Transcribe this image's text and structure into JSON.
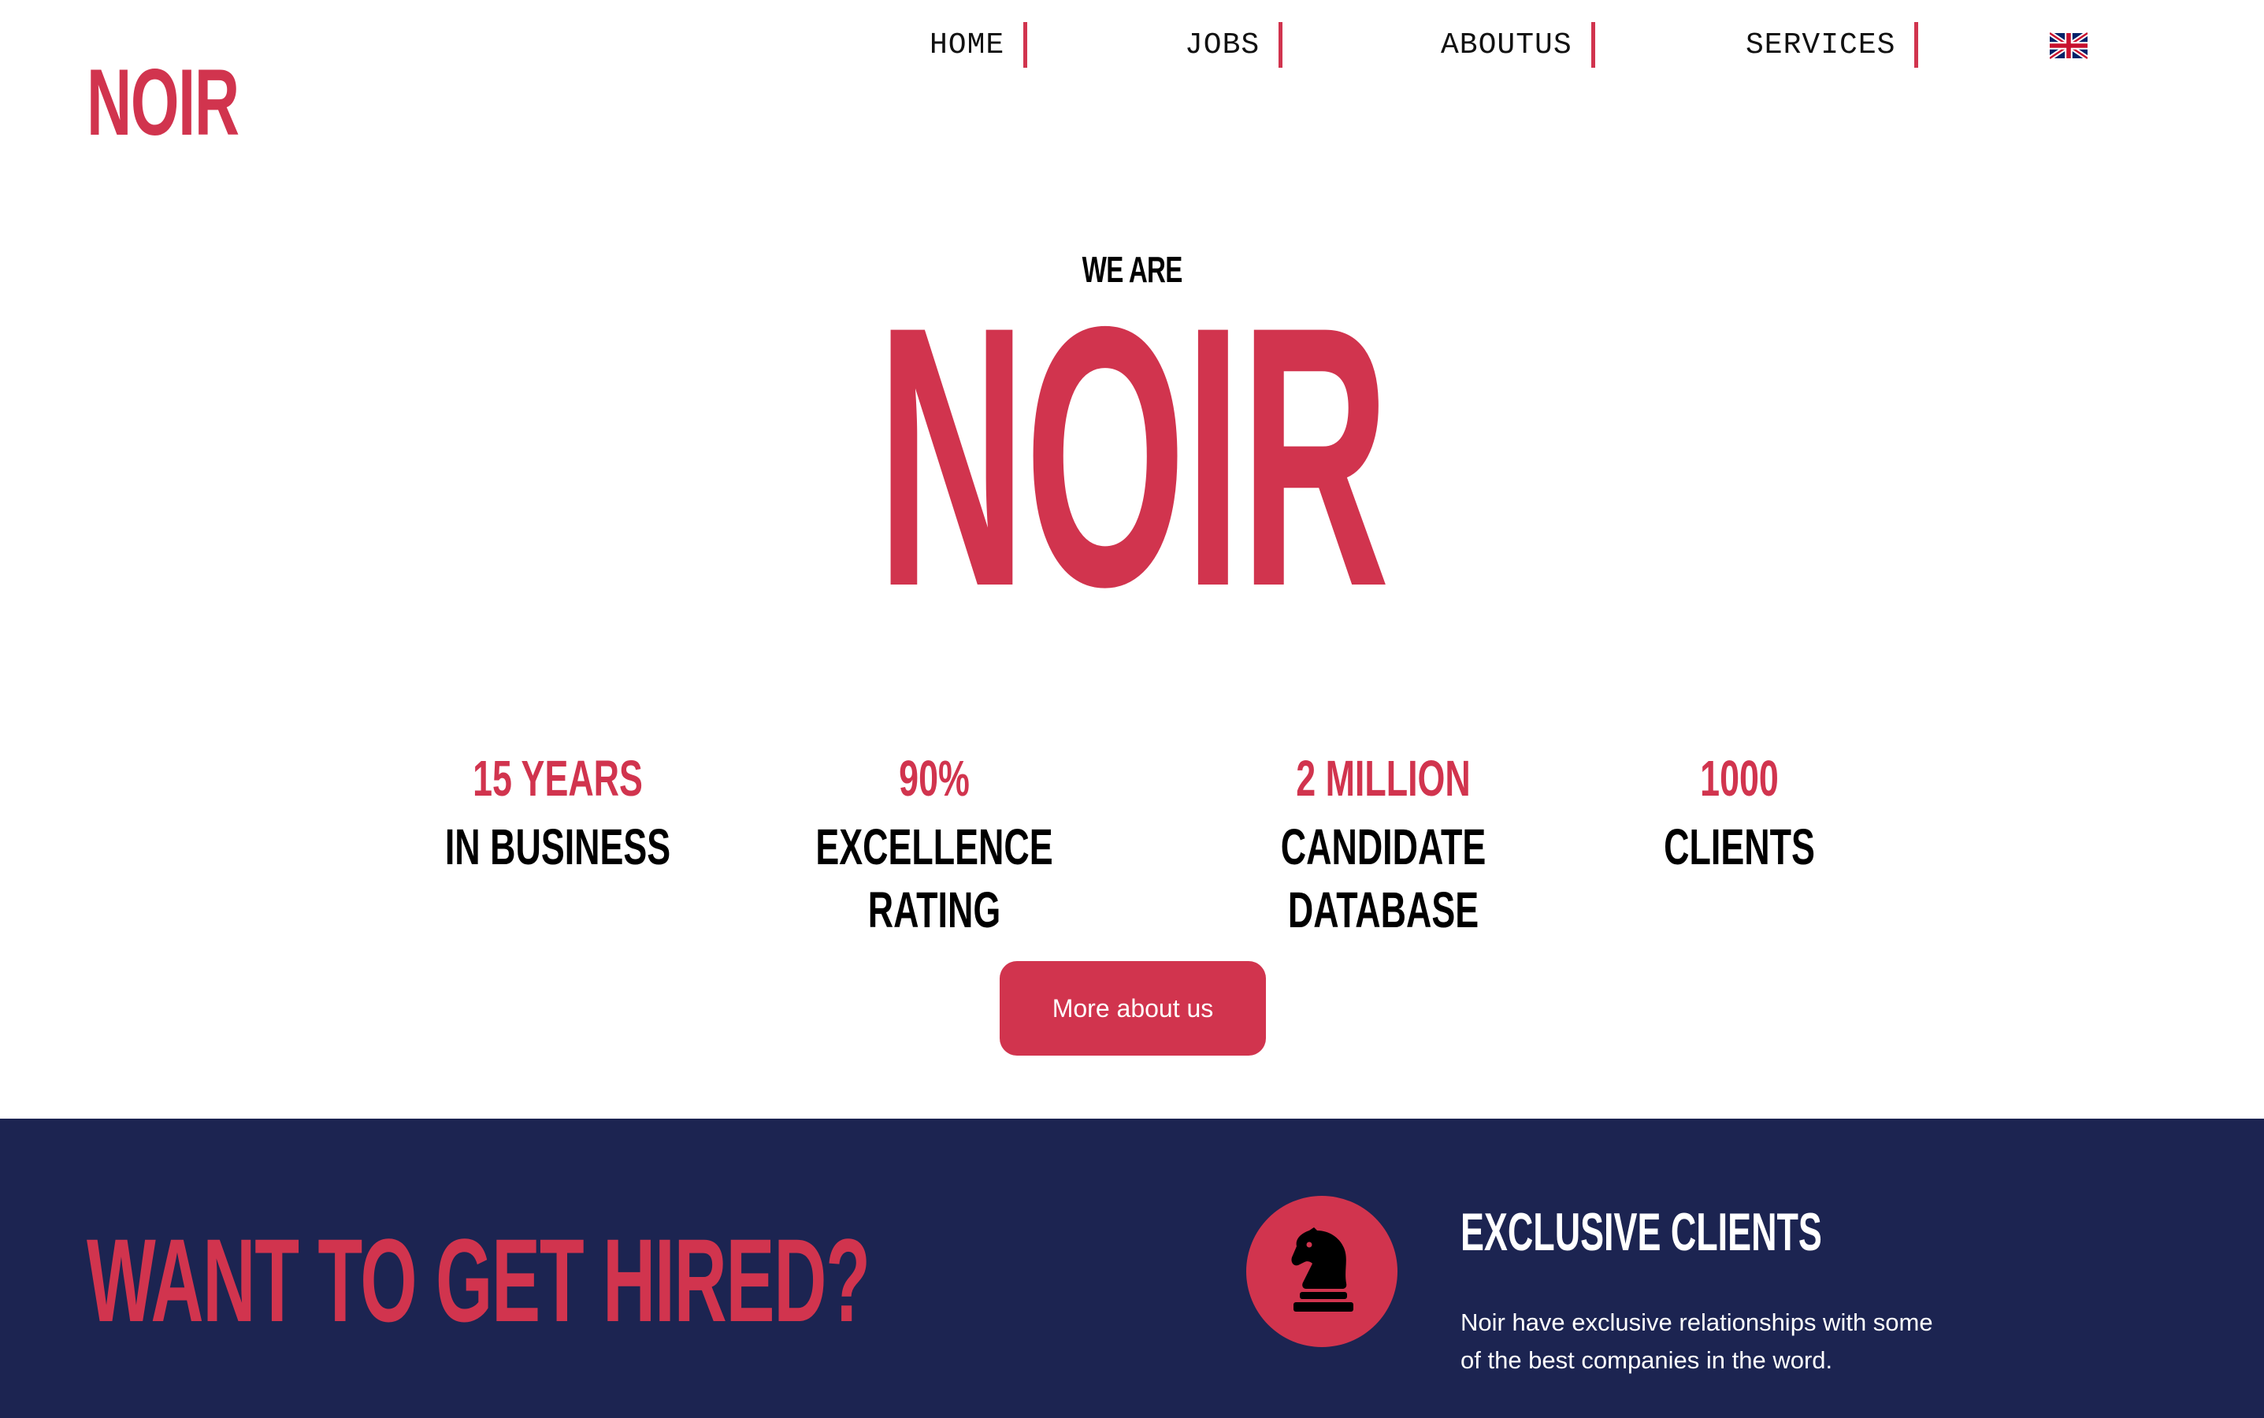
{
  "header": {
    "logo": "NOIR",
    "nav": [
      {
        "label": "HOME"
      },
      {
        "label": "JOBS"
      },
      {
        "label": "ABOUTUS"
      },
      {
        "label": "SERVICES"
      }
    ],
    "language_icon": "uk-flag-icon"
  },
  "hero": {
    "eyebrow": "WE ARE",
    "title": "NOIR"
  },
  "stats": [
    {
      "value": "15 YEARS",
      "label": "IN BUSINESS"
    },
    {
      "value": "90%",
      "label": "EXCELLENCE RATING"
    },
    {
      "value": "2 MILLION",
      "label": "CANDIDATE DATABASE"
    },
    {
      "value": "1000",
      "label": "CLIENTS"
    }
  ],
  "cta": {
    "label": "More about us"
  },
  "hire_section": {
    "heading": "WANT TO GET HIRED?",
    "feature": {
      "icon": "chess-knight-icon",
      "title": "EXCLUSIVE CLIENTS",
      "text": "Noir have exclusive relationships with some of the best companies in the word."
    }
  },
  "colors": {
    "accent": "#d1344e",
    "dark_navy": "#1c2451",
    "text": "#000000",
    "background": "#ffffff"
  }
}
